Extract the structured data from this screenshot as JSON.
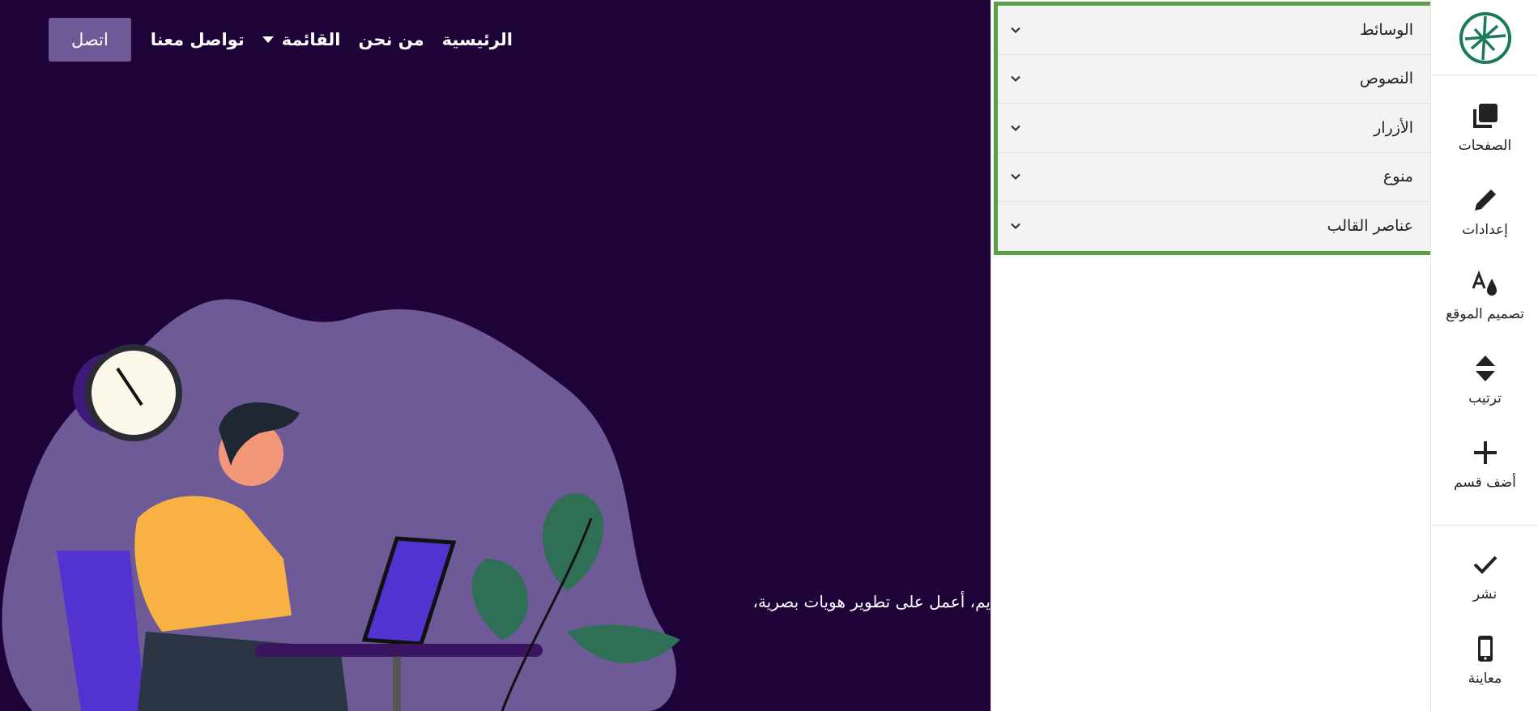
{
  "site": {
    "nav": {
      "cta": "اتصل",
      "links": [
        "تواصل معنا",
        "القائمة",
        "من نحن",
        "الرئيسية"
      ]
    },
    "hero_text": "يم، أعمل على تطوير هويات بصرية،",
    "colors": {
      "background": "#1e0339",
      "blob": "#6e5a97",
      "cta": "#6e5a97"
    }
  },
  "panel": {
    "accordion": [
      {
        "label": "الوسائط",
        "icon": "chevron-down-icon"
      },
      {
        "label": "النصوص",
        "icon": "chevron-down-icon"
      },
      {
        "label": "الأزرار",
        "icon": "chevron-down-icon"
      },
      {
        "label": "منوع",
        "icon": "chevron-down-icon"
      },
      {
        "label": "عناصر القالب",
        "icon": "chevron-down-icon"
      }
    ],
    "highlight_color": "#5a9e46"
  },
  "toolbar": {
    "logo_icon": "leaf-logo-icon",
    "items": [
      {
        "label": "الصفحات",
        "icon": "pages-icon"
      },
      {
        "label": "إعدادات",
        "icon": "pencil-icon"
      },
      {
        "label": "تصميم الموقع",
        "icon": "design-icon"
      },
      {
        "label": "ترتيب",
        "icon": "sort-icon"
      },
      {
        "label": "أضف قسم",
        "icon": "plus-icon"
      },
      {
        "label": "نشر",
        "icon": "check-icon"
      },
      {
        "label": "معاينة",
        "icon": "mobile-icon"
      }
    ],
    "logo_color": "#1a7a5a"
  }
}
